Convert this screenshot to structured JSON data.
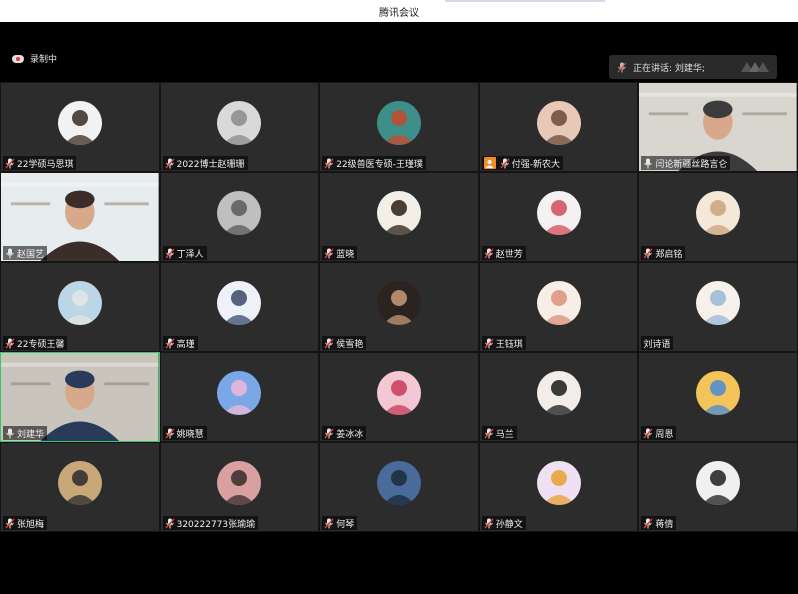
{
  "window": {
    "title": "腾讯会议"
  },
  "status": {
    "recording_label": "录制中",
    "speaking_text": "正在讲话: 刘建华;"
  },
  "colors": {
    "tile_bg": "#2c2c2c",
    "active_border": "#39c56d",
    "mic_muted": "#e53935",
    "host_badge": "#f28c28"
  },
  "participants": [
    {
      "name": "22学硕马思琪",
      "mic": "muted",
      "tile": "avatar",
      "avatar_colors": [
        "#f2f2f2",
        "#3a2a22"
      ]
    },
    {
      "name": "2022博士赵珊珊",
      "mic": "muted",
      "tile": "avatar",
      "avatar_colors": [
        "#d9d9d9",
        "#8a8a8a"
      ]
    },
    {
      "name": "22级兽医专硕-王瑾璞",
      "mic": "muted",
      "tile": "avatar",
      "avatar_colors": [
        "#3d8f8a",
        "#c84a2a"
      ]
    },
    {
      "name": "付强-新农大",
      "mic": "muted",
      "tile": "avatar",
      "host": true,
      "avatar_colors": [
        "#e8c9b8",
        "#6a4b3a"
      ]
    },
    {
      "name": "闫论新疆丝路言仑",
      "mic": "on",
      "tile": "video",
      "video_colors": [
        "#d9d6d0",
        "#3b3b3b"
      ]
    },
    {
      "name": "赵国艺",
      "mic": "on",
      "tile": "video",
      "video_colors": [
        "#e7ecef",
        "#3b2d2a"
      ]
    },
    {
      "name": "丁泽人",
      "mic": "muted",
      "tile": "avatar",
      "avatar_colors": [
        "#bfbfbf",
        "#5a5a5a"
      ]
    },
    {
      "name": "蓝晓",
      "mic": "muted",
      "tile": "avatar",
      "avatar_colors": [
        "#f1efe8",
        "#2a1e14"
      ]
    },
    {
      "name": "赵世芳",
      "mic": "muted",
      "tile": "avatar",
      "avatar_colors": [
        "#f5f0f2",
        "#d44b5a"
      ]
    },
    {
      "name": "郑启铭",
      "mic": "muted",
      "tile": "avatar",
      "avatar_colors": [
        "#f4e8d8",
        "#c8a47a"
      ]
    },
    {
      "name": "22专硕王馨",
      "mic": "muted",
      "tile": "avatar",
      "avatar_colors": [
        "#bcd6e6",
        "#e6e6e6"
      ]
    },
    {
      "name": "高瑾",
      "mic": "muted",
      "tile": "avatar",
      "avatar_colors": [
        "#eef2f8",
        "#3a4a6a"
      ]
    },
    {
      "name": "侯雪艳",
      "mic": "muted",
      "tile": "avatar",
      "avatar_colors": [
        "#2a2320",
        "#c89a78"
      ]
    },
    {
      "name": "王钰琪",
      "mic": "muted",
      "tile": "avatar",
      "avatar_colors": [
        "#f7eee6",
        "#d9907a"
      ]
    },
    {
      "name": "刘诗语",
      "mic": "none",
      "tile": "avatar",
      "avatar_colors": [
        "#f6f1ea",
        "#9ab8d8"
      ]
    },
    {
      "name": "刘建华",
      "mic": "on",
      "tile": "video",
      "active": true,
      "video_colors": [
        "#c9c5bd",
        "#2a3a5a"
      ]
    },
    {
      "name": "姚晓慧",
      "mic": "muted",
      "tile": "avatar",
      "avatar_colors": [
        "#7aa8e6",
        "#f0b8d8"
      ]
    },
    {
      "name": "姜冰冰",
      "mic": "muted",
      "tile": "avatar",
      "avatar_colors": [
        "#f3c8d4",
        "#c83a5a"
      ]
    },
    {
      "name": "马兰",
      "mic": "muted",
      "tile": "avatar",
      "avatar_colors": [
        "#f2ede8",
        "#1a1a1a"
      ]
    },
    {
      "name": "周恩",
      "mic": "muted",
      "tile": "avatar",
      "avatar_colors": [
        "#f2c45a",
        "#4a8ad8"
      ]
    },
    {
      "name": "张旭梅",
      "mic": "muted",
      "tile": "avatar",
      "avatar_colors": [
        "#c8a878",
        "#2a2a2a"
      ]
    },
    {
      "name": "320222773张瑜瑜",
      "mic": "muted",
      "tile": "avatar",
      "avatar_colors": [
        "#d8a0a0",
        "#3a2a2a"
      ]
    },
    {
      "name": "何琴",
      "mic": "muted",
      "tile": "avatar",
      "avatar_colors": [
        "#4a6a9a",
        "#1a2a3a"
      ]
    },
    {
      "name": "孙静文",
      "mic": "muted",
      "tile": "avatar",
      "avatar_colors": [
        "#f0e0f4",
        "#e8a030"
      ]
    },
    {
      "name": "蒋倩",
      "mic": "muted",
      "tile": "avatar",
      "avatar_colors": [
        "#f0f0f0",
        "#1e1e1e"
      ]
    }
  ]
}
